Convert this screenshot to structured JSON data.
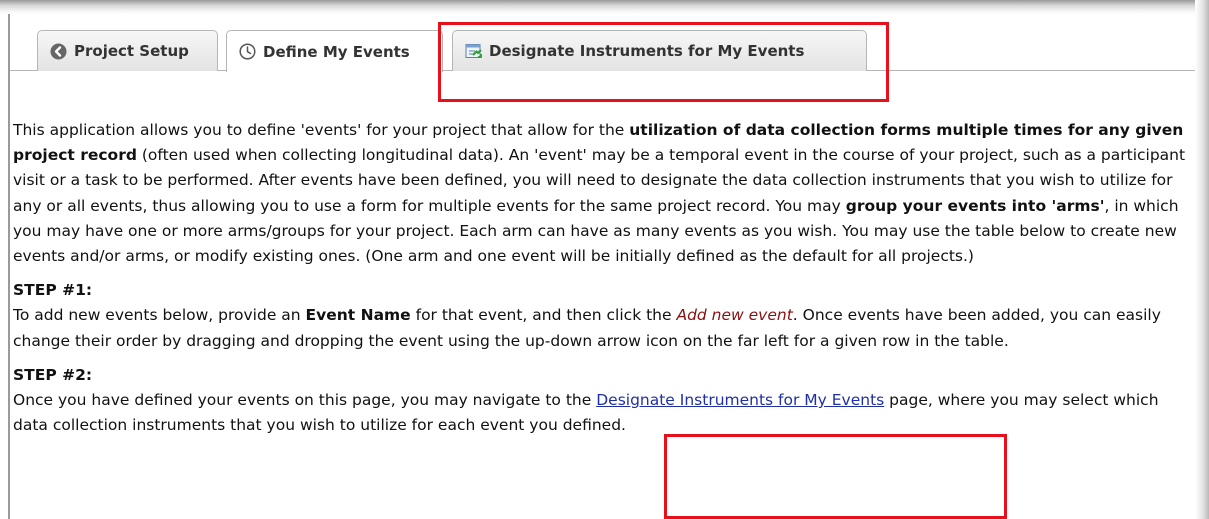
{
  "tabs": [
    {
      "label": "Project Setup",
      "icon": "back-arrow-icon"
    },
    {
      "label": "Define My Events",
      "icon": "clock-icon"
    },
    {
      "label": "Designate Instruments for My Events",
      "icon": "instruments-icon"
    }
  ],
  "intro": {
    "part1": "This application allows you to define 'events' for your project that allow for the ",
    "bold1": "utilization of data collection forms multiple times for any given project record",
    "part2": " (often used when collecting longitudinal data). An 'event' may be a temporal event in the course of your project, such as a participant visit or a task to be performed. After events have been defined, you will need to designate the data collection instruments that you wish to utilize for any or all events, thus allowing you to use a form for multiple events for the same project record. You may ",
    "bold2": "group your events into 'arms'",
    "part3": ", in which you may have one or more arms/groups for your project. Each arm can have as many events as you wish. You may use the table below to create new events and/or arms, or modify existing ones. (One arm and one event will be initially defined as the default for all projects.)"
  },
  "step1": {
    "heading": "STEP #1:",
    "part1": "To add new events below, provide an ",
    "bold": "Event Name",
    "part2": " for that event, and then click the ",
    "italic": "Add new event",
    "part3": ". Once events have been added, you can easily change their order by dragging and dropping the event using the up-down arrow icon on the far left for a given row in the table."
  },
  "step2": {
    "heading": "STEP #2:",
    "part1": "Once you have defined your events on this page, you may navigate to the ",
    "link": "Designate Instruments for My Events",
    "part2": " page, where you may select which data collection instruments that you wish to utilize for each event you defined."
  },
  "colors": {
    "highlight_box": "#e8101a",
    "link": "#1f2fa8",
    "italic_text": "#8a1010"
  }
}
